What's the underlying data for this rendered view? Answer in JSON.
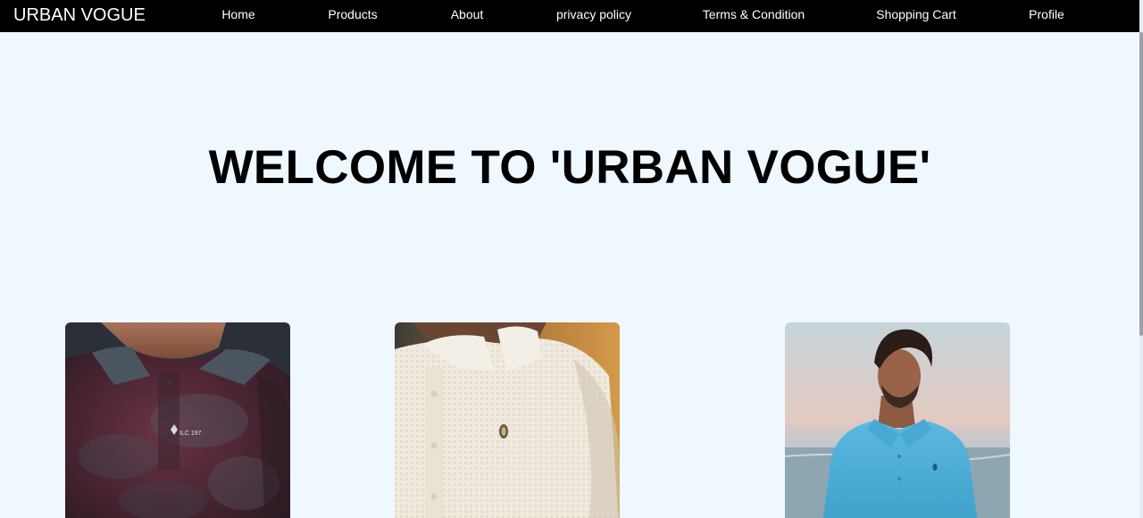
{
  "navbar": {
    "brand": "URBAN VOGUE",
    "links": [
      {
        "label": "Home"
      },
      {
        "label": "Products"
      },
      {
        "label": "About"
      },
      {
        "label": "privacy policy"
      },
      {
        "label": "Terms & Condition"
      },
      {
        "label": "Shopping Cart"
      },
      {
        "label": "Profile"
      }
    ]
  },
  "hero": {
    "title": "WELCOME TO 'URBAN VOGUE'"
  },
  "products": [
    {
      "image": "maroon-polo-shirt",
      "logo_text": "ILC 197"
    },
    {
      "image": "white-textured-polo-shirt"
    },
    {
      "image": "man-in-blue-polo-at-beach"
    }
  ],
  "colors": {
    "navbar_bg": "#000000",
    "page_bg": "#f0f8ff",
    "title": "#000000"
  }
}
